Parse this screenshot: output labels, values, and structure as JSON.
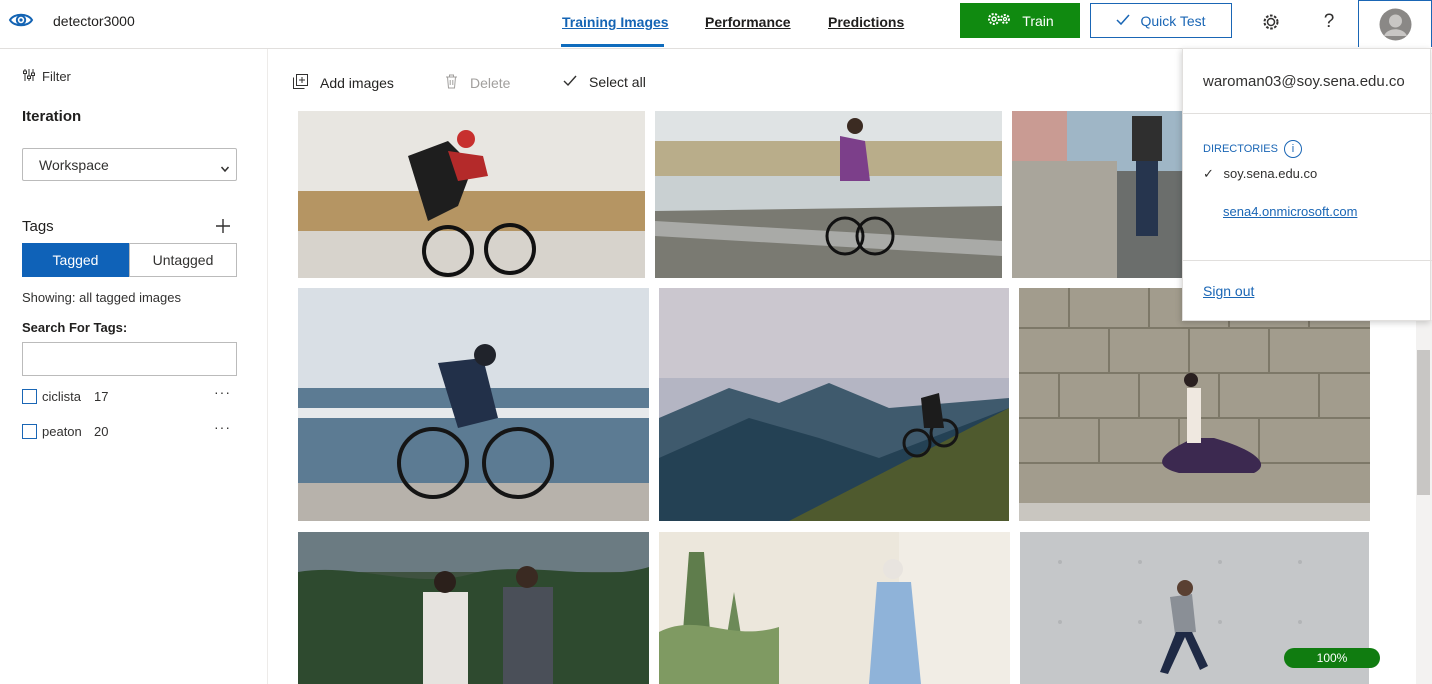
{
  "header": {
    "project_name": "detector3000",
    "tabs": [
      {
        "label": "Training Images",
        "active": true
      },
      {
        "label": "Performance",
        "active": false
      },
      {
        "label": "Predictions",
        "active": false
      }
    ],
    "train_label": "Train",
    "quick_test_label": "Quick Test",
    "help_label": "?",
    "icons": {
      "logo": "eye-icon",
      "train": "gears-icon",
      "quick_test": "checkmark-icon",
      "settings": "gear-icon",
      "account": "avatar"
    }
  },
  "sidebar": {
    "filter_label": "Filter",
    "iteration_heading": "Iteration",
    "iteration_value": "Workspace",
    "tags_heading": "Tags",
    "segments": {
      "tagged": "Tagged",
      "untagged": "Untagged"
    },
    "showing_text": "Showing: all tagged images",
    "search_label": "Search For Tags:",
    "search_value": "",
    "tags": [
      {
        "name": "ciclista",
        "count": "17"
      },
      {
        "name": "peaton",
        "count": "20"
      }
    ],
    "more_label": "···"
  },
  "toolbar": {
    "add_images": "Add images",
    "delete": "Delete",
    "select_all": "Select all"
  },
  "images": [
    "cyclist-road-field",
    "cyclist-lake-path",
    "man-standing-street",
    "cyclist-harbor",
    "mountain-biker-sunset",
    "dancer-stone-wall",
    "couple-cycling",
    "woman-walking-cactus",
    "man-running-concrete"
  ],
  "progress_label": "100%",
  "account_menu": {
    "email": "waroman03@soy.sena.edu.co",
    "directories_heading": "DIRECTORIES",
    "directories": [
      {
        "check": "✓",
        "name": "soy.sena.edu.co"
      },
      {
        "name": "sena4.onmicrosoft.com"
      }
    ],
    "sign_out": "Sign out"
  },
  "colors": {
    "accent": "#1a66b5",
    "train": "#108a10",
    "progress": "#107c10"
  }
}
